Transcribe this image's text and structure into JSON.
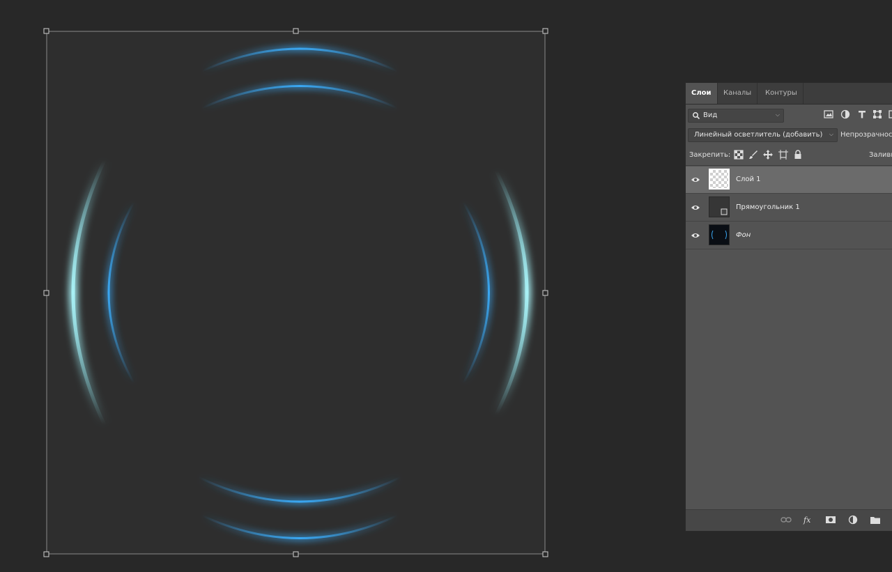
{
  "colors": {
    "background": "#282828",
    "canvas": "#2e2e2e",
    "arc_blue": "#3aa7f2",
    "arc_cyan": "#8fe6f0"
  },
  "layers_panel": {
    "tabs": [
      {
        "label": "Слои",
        "active": true
      },
      {
        "label": "Каналы",
        "active": false
      },
      {
        "label": "Контуры",
        "active": false
      }
    ],
    "filter": {
      "label": "Вид",
      "icon": "search-icon"
    },
    "filter_icons": [
      "image-filter-icon",
      "adjustment-filter-icon",
      "type-filter-icon",
      "shape-filter-icon",
      "smart-object-filter-icon"
    ],
    "blend_mode": "Линейный осветлитель (добавить)",
    "opacity_label": "Непрозрачность:",
    "lock_label": "Закрепить:",
    "lock_icons": [
      "lock-transparent-icon",
      "lock-paint-icon",
      "lock-position-icon",
      "lock-artboard-icon",
      "lock-all-icon"
    ],
    "fill_label": "Заливка:",
    "layers": [
      {
        "name": "Слой 1",
        "selected": true,
        "visible": true,
        "thumb": "transparent"
      },
      {
        "name": "Прямоугольник 1",
        "selected": false,
        "visible": true,
        "thumb": "shape"
      },
      {
        "name": "Фон",
        "selected": false,
        "visible": true,
        "thumb": "dark",
        "italic": true
      }
    ],
    "bottom_icons": [
      "link-layers-icon",
      "fx-icon",
      "add-mask-icon",
      "adjustment-layer-icon",
      "new-group-icon"
    ]
  }
}
